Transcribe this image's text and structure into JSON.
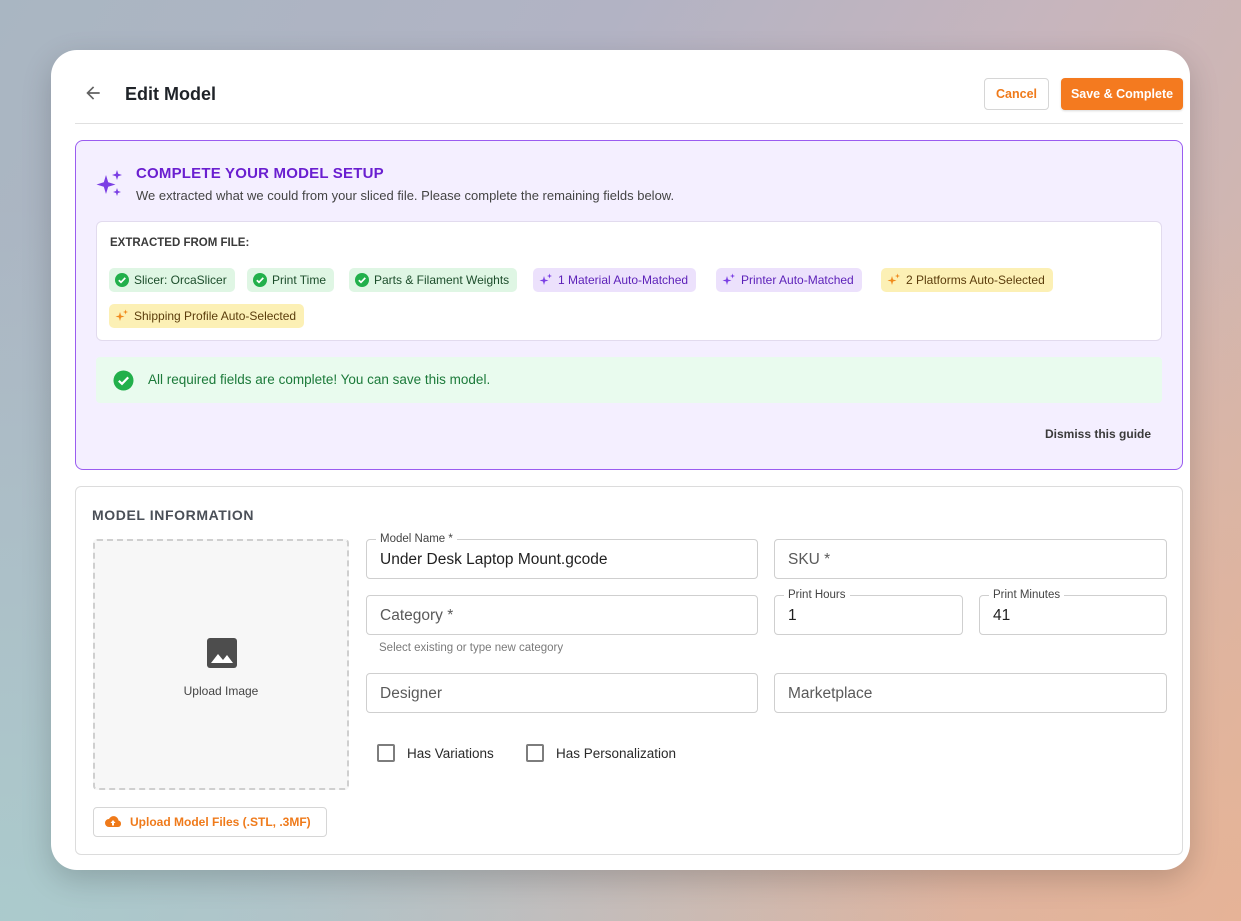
{
  "header": {
    "title": "Edit Model",
    "cancel_label": "Cancel",
    "save_label": "Save & Complete"
  },
  "setup": {
    "title": "COMPLETE YOUR MODEL SETUP",
    "subtitle": "We extracted what we could from your sliced file. Please complete the remaining fields below.",
    "extracted_label": "EXTRACTED FROM FILE:",
    "chips": [
      {
        "label": "Slicer: OrcaSlicer",
        "variant": "green",
        "icon": "check-circle-icon"
      },
      {
        "label": "Print Time",
        "variant": "green",
        "icon": "check-circle-icon"
      },
      {
        "label": "Parts & Filament Weights",
        "variant": "green",
        "icon": "check-circle-icon"
      },
      {
        "label": "1 Material Auto-Matched",
        "variant": "purple",
        "icon": "sparkle-icon"
      },
      {
        "label": "Printer Auto-Matched",
        "variant": "purple",
        "icon": "sparkle-icon"
      },
      {
        "label": "2 Platforms Auto-Selected",
        "variant": "yellow",
        "icon": "sparkle-icon"
      },
      {
        "label": "Shipping Profile Auto-Selected",
        "variant": "yellow",
        "icon": "sparkle-icon"
      }
    ],
    "success_message": "All required fields are complete! You can save this model.",
    "dismiss_label": "Dismiss this guide"
  },
  "model_info": {
    "section_title": "MODEL INFORMATION",
    "upload_image_label": "Upload Image",
    "upload_files_label": "Upload Model Files (.STL, .3MF)",
    "model_name": {
      "label": "Model Name *",
      "value": "Under Desk Laptop Mount.gcode"
    },
    "sku": {
      "placeholder": "SKU *"
    },
    "category": {
      "placeholder": "Category *",
      "helper": "Select existing or type new category"
    },
    "print_hours": {
      "label": "Print Hours",
      "value": "1"
    },
    "print_minutes": {
      "label": "Print Minutes",
      "value": "41"
    },
    "designer": {
      "placeholder": "Designer"
    },
    "marketplace": {
      "placeholder": "Marketplace"
    },
    "has_variations": {
      "label": "Has Variations",
      "checked": false
    },
    "has_personalization": {
      "label": "Has Personalization",
      "checked": false
    }
  },
  "colors": {
    "accent": "#f47a1f",
    "setup_accent": "#6a1fd0",
    "success": "#1c7a3a"
  }
}
